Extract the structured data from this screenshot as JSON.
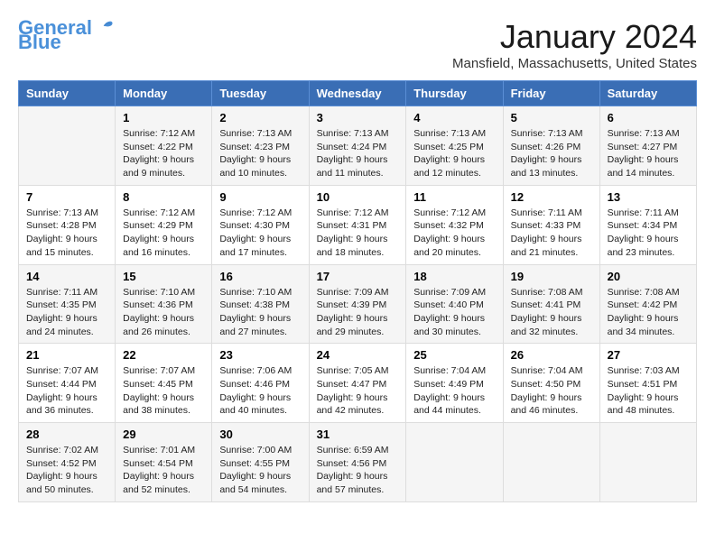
{
  "logo": {
    "line1": "General",
    "line2": "Blue"
  },
  "header": {
    "month": "January 2024",
    "location": "Mansfield, Massachusetts, United States"
  },
  "weekdays": [
    "Sunday",
    "Monday",
    "Tuesday",
    "Wednesday",
    "Thursday",
    "Friday",
    "Saturday"
  ],
  "weeks": [
    [
      {
        "day": "",
        "text": ""
      },
      {
        "day": "1",
        "text": "Sunrise: 7:12 AM\nSunset: 4:22 PM\nDaylight: 9 hours\nand 9 minutes."
      },
      {
        "day": "2",
        "text": "Sunrise: 7:13 AM\nSunset: 4:23 PM\nDaylight: 9 hours\nand 10 minutes."
      },
      {
        "day": "3",
        "text": "Sunrise: 7:13 AM\nSunset: 4:24 PM\nDaylight: 9 hours\nand 11 minutes."
      },
      {
        "day": "4",
        "text": "Sunrise: 7:13 AM\nSunset: 4:25 PM\nDaylight: 9 hours\nand 12 minutes."
      },
      {
        "day": "5",
        "text": "Sunrise: 7:13 AM\nSunset: 4:26 PM\nDaylight: 9 hours\nand 13 minutes."
      },
      {
        "day": "6",
        "text": "Sunrise: 7:13 AM\nSunset: 4:27 PM\nDaylight: 9 hours\nand 14 minutes."
      }
    ],
    [
      {
        "day": "7",
        "text": "Sunrise: 7:13 AM\nSunset: 4:28 PM\nDaylight: 9 hours\nand 15 minutes."
      },
      {
        "day": "8",
        "text": "Sunrise: 7:12 AM\nSunset: 4:29 PM\nDaylight: 9 hours\nand 16 minutes."
      },
      {
        "day": "9",
        "text": "Sunrise: 7:12 AM\nSunset: 4:30 PM\nDaylight: 9 hours\nand 17 minutes."
      },
      {
        "day": "10",
        "text": "Sunrise: 7:12 AM\nSunset: 4:31 PM\nDaylight: 9 hours\nand 18 minutes."
      },
      {
        "day": "11",
        "text": "Sunrise: 7:12 AM\nSunset: 4:32 PM\nDaylight: 9 hours\nand 20 minutes."
      },
      {
        "day": "12",
        "text": "Sunrise: 7:11 AM\nSunset: 4:33 PM\nDaylight: 9 hours\nand 21 minutes."
      },
      {
        "day": "13",
        "text": "Sunrise: 7:11 AM\nSunset: 4:34 PM\nDaylight: 9 hours\nand 23 minutes."
      }
    ],
    [
      {
        "day": "14",
        "text": "Sunrise: 7:11 AM\nSunset: 4:35 PM\nDaylight: 9 hours\nand 24 minutes."
      },
      {
        "day": "15",
        "text": "Sunrise: 7:10 AM\nSunset: 4:36 PM\nDaylight: 9 hours\nand 26 minutes."
      },
      {
        "day": "16",
        "text": "Sunrise: 7:10 AM\nSunset: 4:38 PM\nDaylight: 9 hours\nand 27 minutes."
      },
      {
        "day": "17",
        "text": "Sunrise: 7:09 AM\nSunset: 4:39 PM\nDaylight: 9 hours\nand 29 minutes."
      },
      {
        "day": "18",
        "text": "Sunrise: 7:09 AM\nSunset: 4:40 PM\nDaylight: 9 hours\nand 30 minutes."
      },
      {
        "day": "19",
        "text": "Sunrise: 7:08 AM\nSunset: 4:41 PM\nDaylight: 9 hours\nand 32 minutes."
      },
      {
        "day": "20",
        "text": "Sunrise: 7:08 AM\nSunset: 4:42 PM\nDaylight: 9 hours\nand 34 minutes."
      }
    ],
    [
      {
        "day": "21",
        "text": "Sunrise: 7:07 AM\nSunset: 4:44 PM\nDaylight: 9 hours\nand 36 minutes."
      },
      {
        "day": "22",
        "text": "Sunrise: 7:07 AM\nSunset: 4:45 PM\nDaylight: 9 hours\nand 38 minutes."
      },
      {
        "day": "23",
        "text": "Sunrise: 7:06 AM\nSunset: 4:46 PM\nDaylight: 9 hours\nand 40 minutes."
      },
      {
        "day": "24",
        "text": "Sunrise: 7:05 AM\nSunset: 4:47 PM\nDaylight: 9 hours\nand 42 minutes."
      },
      {
        "day": "25",
        "text": "Sunrise: 7:04 AM\nSunset: 4:49 PM\nDaylight: 9 hours\nand 44 minutes."
      },
      {
        "day": "26",
        "text": "Sunrise: 7:04 AM\nSunset: 4:50 PM\nDaylight: 9 hours\nand 46 minutes."
      },
      {
        "day": "27",
        "text": "Sunrise: 7:03 AM\nSunset: 4:51 PM\nDaylight: 9 hours\nand 48 minutes."
      }
    ],
    [
      {
        "day": "28",
        "text": "Sunrise: 7:02 AM\nSunset: 4:52 PM\nDaylight: 9 hours\nand 50 minutes."
      },
      {
        "day": "29",
        "text": "Sunrise: 7:01 AM\nSunset: 4:54 PM\nDaylight: 9 hours\nand 52 minutes."
      },
      {
        "day": "30",
        "text": "Sunrise: 7:00 AM\nSunset: 4:55 PM\nDaylight: 9 hours\nand 54 minutes."
      },
      {
        "day": "31",
        "text": "Sunrise: 6:59 AM\nSunset: 4:56 PM\nDaylight: 9 hours\nand 57 minutes."
      },
      {
        "day": "",
        "text": ""
      },
      {
        "day": "",
        "text": ""
      },
      {
        "day": "",
        "text": ""
      }
    ]
  ]
}
